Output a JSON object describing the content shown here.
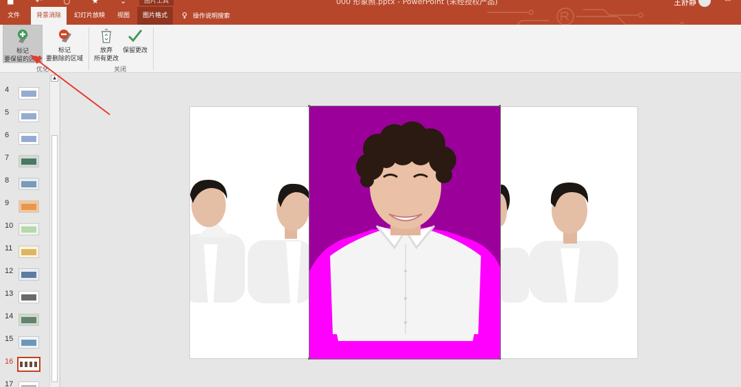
{
  "titlebar": {
    "doc_title": "000 形象照.pptx  -  PowerPoint (未经授权产品)",
    "context_label": "图片工具",
    "user": "王舒静"
  },
  "tabs": [
    {
      "label": "文件"
    },
    {
      "label": "背景消除"
    },
    {
      "label": "幻灯片放映"
    },
    {
      "label": "视图"
    },
    {
      "label": "图片格式"
    },
    {
      "label": "操作说明搜索"
    }
  ],
  "ribbon": {
    "mark_keep": {
      "line1": "标记",
      "line2": "要保留的区域"
    },
    "mark_remove": {
      "line1": "标记",
      "line2": "要删除的区域"
    },
    "discard": {
      "line1": "放弃",
      "line2": "所有更改"
    },
    "keep_changes": {
      "line1": "保留更改",
      "line2": ""
    },
    "group_optimize": "优化",
    "group_close": "关闭"
  },
  "slides": [
    {
      "num": "4"
    },
    {
      "num": "5"
    },
    {
      "num": "6"
    },
    {
      "num": "7"
    },
    {
      "num": "8"
    },
    {
      "num": "9"
    },
    {
      "num": "10"
    },
    {
      "num": "11"
    },
    {
      "num": "12"
    },
    {
      "num": "13"
    },
    {
      "num": "14"
    },
    {
      "num": "15"
    },
    {
      "num": "16"
    },
    {
      "num": "17"
    }
  ],
  "current_slide": "16",
  "colors": {
    "accent": "#b7472a",
    "removal_overlay": "#9b009b",
    "removal_overlay_bright": "#ff00ff",
    "current_slide": "#c43e1c"
  }
}
